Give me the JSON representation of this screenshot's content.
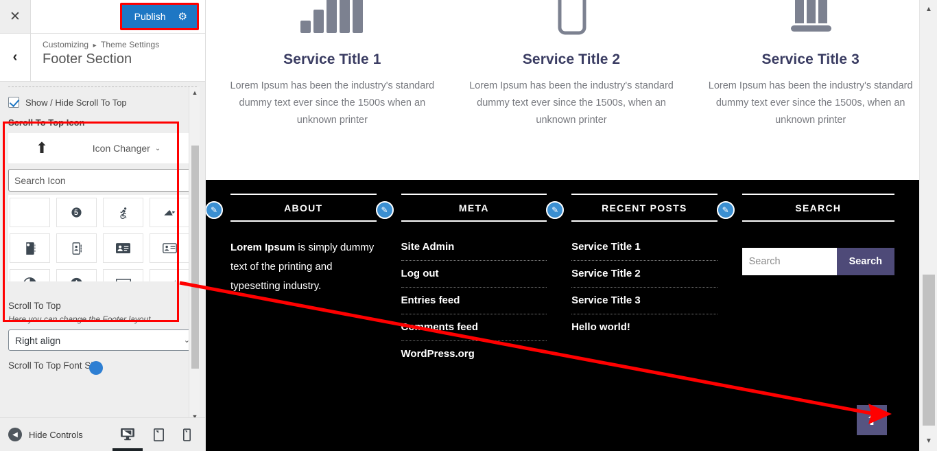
{
  "customizer": {
    "close_icon": "✕",
    "publish_label": "Publish",
    "publish_gear_icon": "gear-icon",
    "back_icon": "‹",
    "breadcrumb_root": "Customizing",
    "breadcrumb_sep": "▸",
    "breadcrumb_current": "Theme Settings",
    "panel_title": "Footer Section",
    "show_hide_label": "Show / Hide Scroll To Top",
    "show_hide_checked": true,
    "icon_control": {
      "title": "Scroll To Top Icon",
      "preview_icon": "⬆",
      "changer_label": "Icon Changer",
      "caret": "⌄",
      "search_placeholder": "Search Icon",
      "search_value": "",
      "icons": [
        "",
        "500px",
        "accessible",
        "accusoft",
        "address-book-solid",
        "address-book",
        "address-card-solid",
        "address-card",
        "adjust",
        "adversal",
        "ad",
        "affiliatetheme"
      ]
    },
    "layout_control": {
      "label": "Scroll To Top",
      "description": "Here you can change the Footer layout.",
      "selected": "Right align",
      "caret": "⌄"
    },
    "font_size_label": "Scroll To Top Font Size",
    "footer": {
      "hide_controls_label": "Hide Controls",
      "hide_controls_icon": "◀",
      "devices": [
        {
          "name": "desktop",
          "icon": "desktop-icon",
          "active": true
        },
        {
          "name": "tablet",
          "icon": "tablet-icon",
          "active": false
        },
        {
          "name": "mobile",
          "icon": "mobile-icon",
          "active": false
        }
      ]
    }
  },
  "preview": {
    "services": [
      {
        "icon": "signal-bars-icon",
        "title": "Service Title 1",
        "text": "Lorem Ipsum has been the industry's standard dummy text ever since the 1500s when an unknown printer"
      },
      {
        "icon": "rounded-rect-icon",
        "title": "Service Title 2",
        "text": "Lorem Ipsum has been the industry's standard dummy text ever since the 1500s, when an unknown printer"
      },
      {
        "icon": "columns-icon",
        "title": "Service Title 3",
        "text": "Lorem Ipsum has been the industry's standard dummy text ever since the 1500s, when an unknown printer"
      }
    ],
    "footer": {
      "edit_icon": "✎",
      "widgets": [
        {
          "title": "ABOUT",
          "type": "text",
          "bold_lead": "Lorem Ipsum",
          "body": " is simply dummy text of the printing and typesetting industry."
        },
        {
          "title": "META",
          "type": "list",
          "items": [
            "Site Admin",
            "Log out",
            "Entries feed",
            "Comments feed",
            "WordPress.org"
          ]
        },
        {
          "title": "RECENT POSTS",
          "type": "list",
          "items": [
            "Service Title 1",
            "Service Title 2",
            "Service Title 3",
            "Hello world!"
          ]
        },
        {
          "title": "SEARCH",
          "type": "search",
          "placeholder": "Search",
          "value": "",
          "button_label": "Search"
        }
      ],
      "scroll_top_icon": "⬆"
    }
  },
  "colors": {
    "publish_blue": "#1e77c4",
    "annotation_red": "#ff0000",
    "footer_bg": "#000000",
    "scroll_top_bg": "#565481",
    "search_button_bg": "#4e4a78",
    "edit_pencil_bg": "#3b8fd1",
    "service_title": "#3a3c62"
  }
}
